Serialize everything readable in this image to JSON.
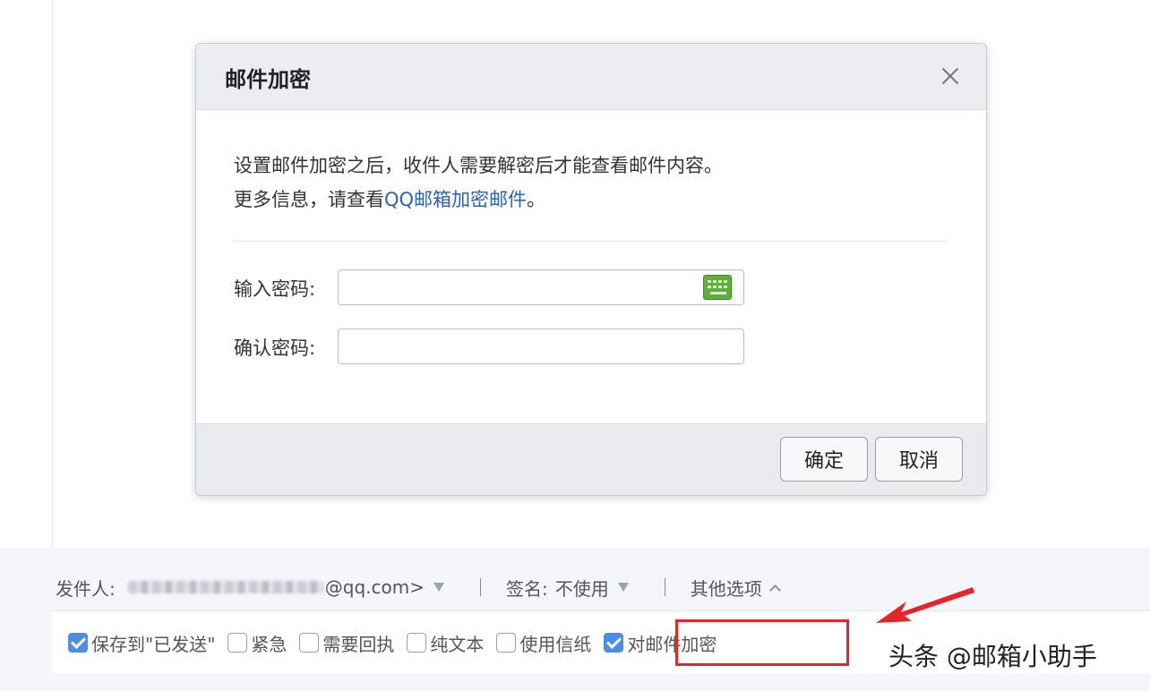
{
  "modal": {
    "title": "邮件加密",
    "description_line1": "设置邮件加密之后，收件人需要解密后才能查看邮件内容。",
    "description_line2_prefix": "更多信息，请查看",
    "description_link": "QQ邮箱加密邮件",
    "description_line2_suffix": "。",
    "password_label": "输入密码:",
    "confirm_label": "确认密码:",
    "password_value": "",
    "confirm_value": "",
    "ok_label": "确定",
    "cancel_label": "取消"
  },
  "sender_row": {
    "sender_label": "发件人:",
    "sender_email_visible": "@qq.com>",
    "signature_label": "签名:",
    "signature_value": "不使用",
    "more_options_label": "其他选项"
  },
  "options": [
    {
      "label": "保存到\"已发送\"",
      "checked": true
    },
    {
      "label": "紧急",
      "checked": false
    },
    {
      "label": "需要回执",
      "checked": false
    },
    {
      "label": "纯文本",
      "checked": false
    },
    {
      "label": "使用信纸",
      "checked": false
    },
    {
      "label": "对邮件加密",
      "checked": true
    }
  ],
  "watermark": "头条 @邮箱小助手",
  "colors": {
    "accent_blue": "#4a90e2",
    "link_blue": "#2a62b8",
    "highlight_red": "#e5252a",
    "keyboard_green": "#5fae3e"
  },
  "icons": {
    "close": "close-icon",
    "keyboard": "keyboard-icon",
    "dropdown": "chevron-down-icon",
    "expand": "chevron-up-icon",
    "annotation": "red-arrow-icon"
  }
}
